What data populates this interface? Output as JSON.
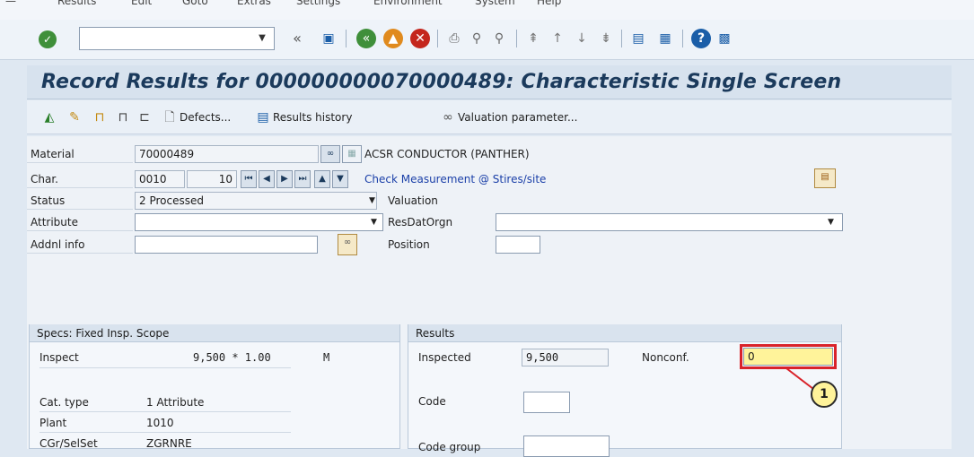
{
  "menubar": {
    "items": [
      "Results",
      "Edit",
      "Goto",
      "Extras",
      "Settings",
      "Environment",
      "System",
      "Help"
    ]
  },
  "toolbar": {
    "command_value": ""
  },
  "title": "Record Results for 000000000070000489: Characteristic Single Screen",
  "app_toolbar": {
    "defects_label": "Defects...",
    "results_history_label": "Results history",
    "valuation_parameter_label": "Valuation parameter..."
  },
  "header": {
    "material_label": "Material",
    "material_value": "70000489",
    "material_desc": "ACSR CONDUCTOR (PANTHER)",
    "char_label": "Char.",
    "char_value": "0010",
    "char_sub": "10",
    "char_desc": "Check Measurement @ Stires/site",
    "status_label": "Status",
    "status_value": "2 Processed",
    "valuation_label": "Valuation",
    "attribute_label": "Attribute",
    "attribute_value": "",
    "resdatorgn_label": "ResDatOrgn",
    "resdatorgn_value": "",
    "addnl_label": "Addnl info",
    "addnl_value": "",
    "position_label": "Position",
    "position_value": ""
  },
  "specs": {
    "header": "Specs: Fixed Insp. Scope",
    "inspect_label": "Inspect",
    "inspect_value": "9,500 * 1.00",
    "inspect_unit": "M",
    "cattype_label": "Cat. type",
    "cattype_value": "1 Attribute",
    "plant_label": "Plant",
    "plant_value": "1010",
    "cgr_label": "CGr/SelSet",
    "cgr_value": "ZGRNRE"
  },
  "results": {
    "header": "Results",
    "inspected_label": "Inspected",
    "inspected_value": "9,500",
    "nonconf_label": "Nonconf.",
    "nonconf_value": "0",
    "code_label": "Code",
    "code_value": "",
    "codegroup_label": "Code group",
    "codegroup_value": ""
  },
  "callout": {
    "number": "1"
  },
  "colors": {
    "title": "#1b3a5c",
    "highlight": "#d9232a",
    "callout_fill": "#fff39a",
    "link": "#1a3fa8"
  }
}
